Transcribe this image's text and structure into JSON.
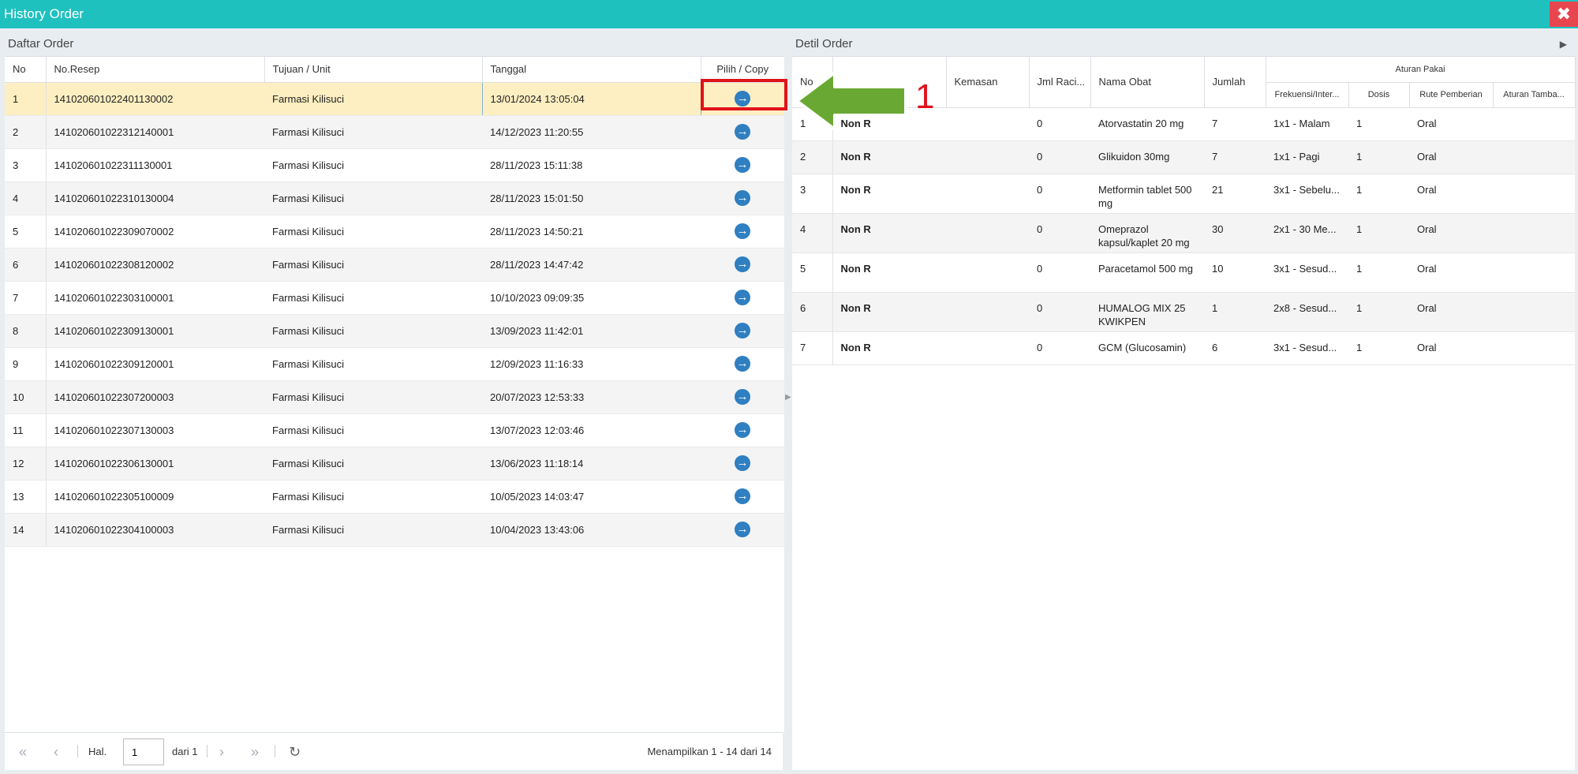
{
  "window": {
    "title": "History Order",
    "close_glyph": "✖"
  },
  "left_panel": {
    "title": "Daftar Order",
    "columns": [
      "No",
      "No.Resep",
      "Tujuan / Unit",
      "Tanggal",
      "Pilih / Copy"
    ],
    "rows": [
      {
        "no": "1",
        "resep": "141020601022401130002",
        "unit": "Farmasi Kilisuci",
        "tanggal": "13/01/2024 13:05:04"
      },
      {
        "no": "2",
        "resep": "141020601022312140001",
        "unit": "Farmasi Kilisuci",
        "tanggal": "14/12/2023 11:20:55"
      },
      {
        "no": "3",
        "resep": "141020601022311130001",
        "unit": "Farmasi Kilisuci",
        "tanggal": "28/11/2023 15:11:38"
      },
      {
        "no": "4",
        "resep": "141020601022310130004",
        "unit": "Farmasi Kilisuci",
        "tanggal": "28/11/2023 15:01:50"
      },
      {
        "no": "5",
        "resep": "141020601022309070002",
        "unit": "Farmasi Kilisuci",
        "tanggal": "28/11/2023 14:50:21"
      },
      {
        "no": "6",
        "resep": "141020601022308120002",
        "unit": "Farmasi Kilisuci",
        "tanggal": "28/11/2023 14:47:42"
      },
      {
        "no": "7",
        "resep": "141020601022303100001",
        "unit": "Farmasi Kilisuci",
        "tanggal": "10/10/2023 09:09:35"
      },
      {
        "no": "8",
        "resep": "141020601022309130001",
        "unit": "Farmasi Kilisuci",
        "tanggal": "13/09/2023 11:42:01"
      },
      {
        "no": "9",
        "resep": "141020601022309120001",
        "unit": "Farmasi Kilisuci",
        "tanggal": "12/09/2023 11:16:33"
      },
      {
        "no": "10",
        "resep": "141020601022307200003",
        "unit": "Farmasi Kilisuci",
        "tanggal": "20/07/2023 12:53:33"
      },
      {
        "no": "11",
        "resep": "141020601022307130003",
        "unit": "Farmasi Kilisuci",
        "tanggal": "13/07/2023 12:03:46"
      },
      {
        "no": "12",
        "resep": "141020601022306130001",
        "unit": "Farmasi Kilisuci",
        "tanggal": "13/06/2023 11:18:14"
      },
      {
        "no": "13",
        "resep": "141020601022305100009",
        "unit": "Farmasi Kilisuci",
        "tanggal": "10/05/2023 14:03:47"
      },
      {
        "no": "14",
        "resep": "141020601022304100003",
        "unit": "Farmasi Kilisuci",
        "tanggal": "10/04/2023 13:43:06"
      }
    ],
    "pick_icon": "→"
  },
  "pager": {
    "first": "«",
    "prev": "‹",
    "page_label": "Hal.",
    "page_value": "1",
    "of_label": "dari 1",
    "next": "›",
    "last": "»",
    "refresh": "↻",
    "summary": "Menampilkan 1 - 14 dari 14"
  },
  "right_panel": {
    "title": "Detil Order",
    "expand_glyph": "▶",
    "columns": [
      "No",
      "",
      "Kemasan",
      "Jml Raci...",
      "Nama Obat",
      "Jumlah",
      "Aturan Pakai"
    ],
    "sub_columns": [
      "Frekuensi/Inter...",
      "Dosis",
      "Rute Pemberian",
      "Aturan Tamba..."
    ],
    "rows": [
      {
        "no": "1",
        "jenis": "Non R",
        "kemasan": "",
        "jml": "0",
        "nama": "Atorvastatin 20 mg",
        "jumlah": "7",
        "frek": "1x1 - Malam",
        "dosis": "1",
        "rute": "Oral",
        "aturan": ""
      },
      {
        "no": "2",
        "jenis": "Non R",
        "kemasan": "",
        "jml": "0",
        "nama": "Glikuidon 30mg",
        "jumlah": "7",
        "frek": "1x1 - Pagi",
        "dosis": "1",
        "rute": "Oral",
        "aturan": ""
      },
      {
        "no": "3",
        "jenis": "Non R",
        "kemasan": "",
        "jml": "0",
        "nama": "Metformin tablet 500 mg",
        "jumlah": "21",
        "frek": "3x1 - Sebelu...",
        "dosis": "1",
        "rute": "Oral",
        "aturan": ""
      },
      {
        "no": "4",
        "jenis": "Non R",
        "kemasan": "",
        "jml": "0",
        "nama": "Omeprazol kapsul/kaplet 20 mg",
        "jumlah": "30",
        "frek": "2x1 - 30 Me...",
        "dosis": "1",
        "rute": "Oral",
        "aturan": ""
      },
      {
        "no": "5",
        "jenis": "Non R",
        "kemasan": "",
        "jml": "0",
        "nama": "Paracetamol 500 mg",
        "jumlah": "10",
        "frek": "3x1 - Sesud...",
        "dosis": "1",
        "rute": "Oral",
        "aturan": ""
      },
      {
        "no": "6",
        "jenis": "Non R",
        "kemasan": "",
        "jml": "0",
        "nama": "HUMALOG MIX 25 KWIKPEN",
        "jumlah": "1",
        "frek": "2x8 - Sesud...",
        "dosis": "1",
        "rute": "Oral",
        "aturan": ""
      },
      {
        "no": "7",
        "jenis": "Non R",
        "kemasan": "",
        "jml": "0",
        "nama": "GCM (Glucosamin)",
        "jumlah": "6",
        "frek": "3x1 - Sesud...",
        "dosis": "1",
        "rute": "Oral",
        "aturan": ""
      }
    ]
  },
  "annotation": {
    "number": "1",
    "color": "#e0121a",
    "arrow_color": "#5a9e2a"
  }
}
